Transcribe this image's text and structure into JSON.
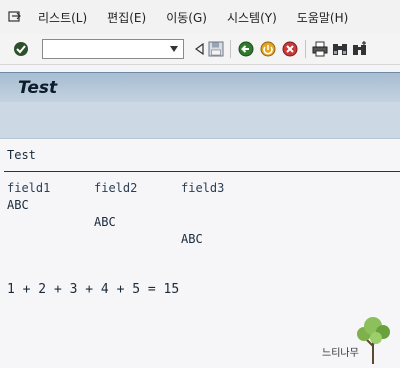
{
  "menu": {
    "items": [
      "리스트(L)",
      "편집(E)",
      "이동(G)",
      "시스템(Y)",
      "도움말(H)"
    ]
  },
  "toolbar": {
    "command_field_value": ""
  },
  "header": {
    "title": "Test"
  },
  "report": {
    "list_title": "Test",
    "columns": [
      "field1",
      "field2",
      "field3"
    ],
    "rows": [
      [
        "ABC",
        "",
        ""
      ],
      [
        "",
        "ABC",
        ""
      ],
      [
        "",
        "",
        "ABC"
      ]
    ],
    "sum_line": "1 + 2 + 3 + 4 + 5 = 15"
  },
  "watermark": {
    "text": "느티나무"
  },
  "colors": {
    "header_gradient_top": "#a7bdd2",
    "header_gradient_bottom": "#c4d3e1",
    "app_toolbar": "#ccd8e4",
    "text": "#1a2a3a"
  }
}
